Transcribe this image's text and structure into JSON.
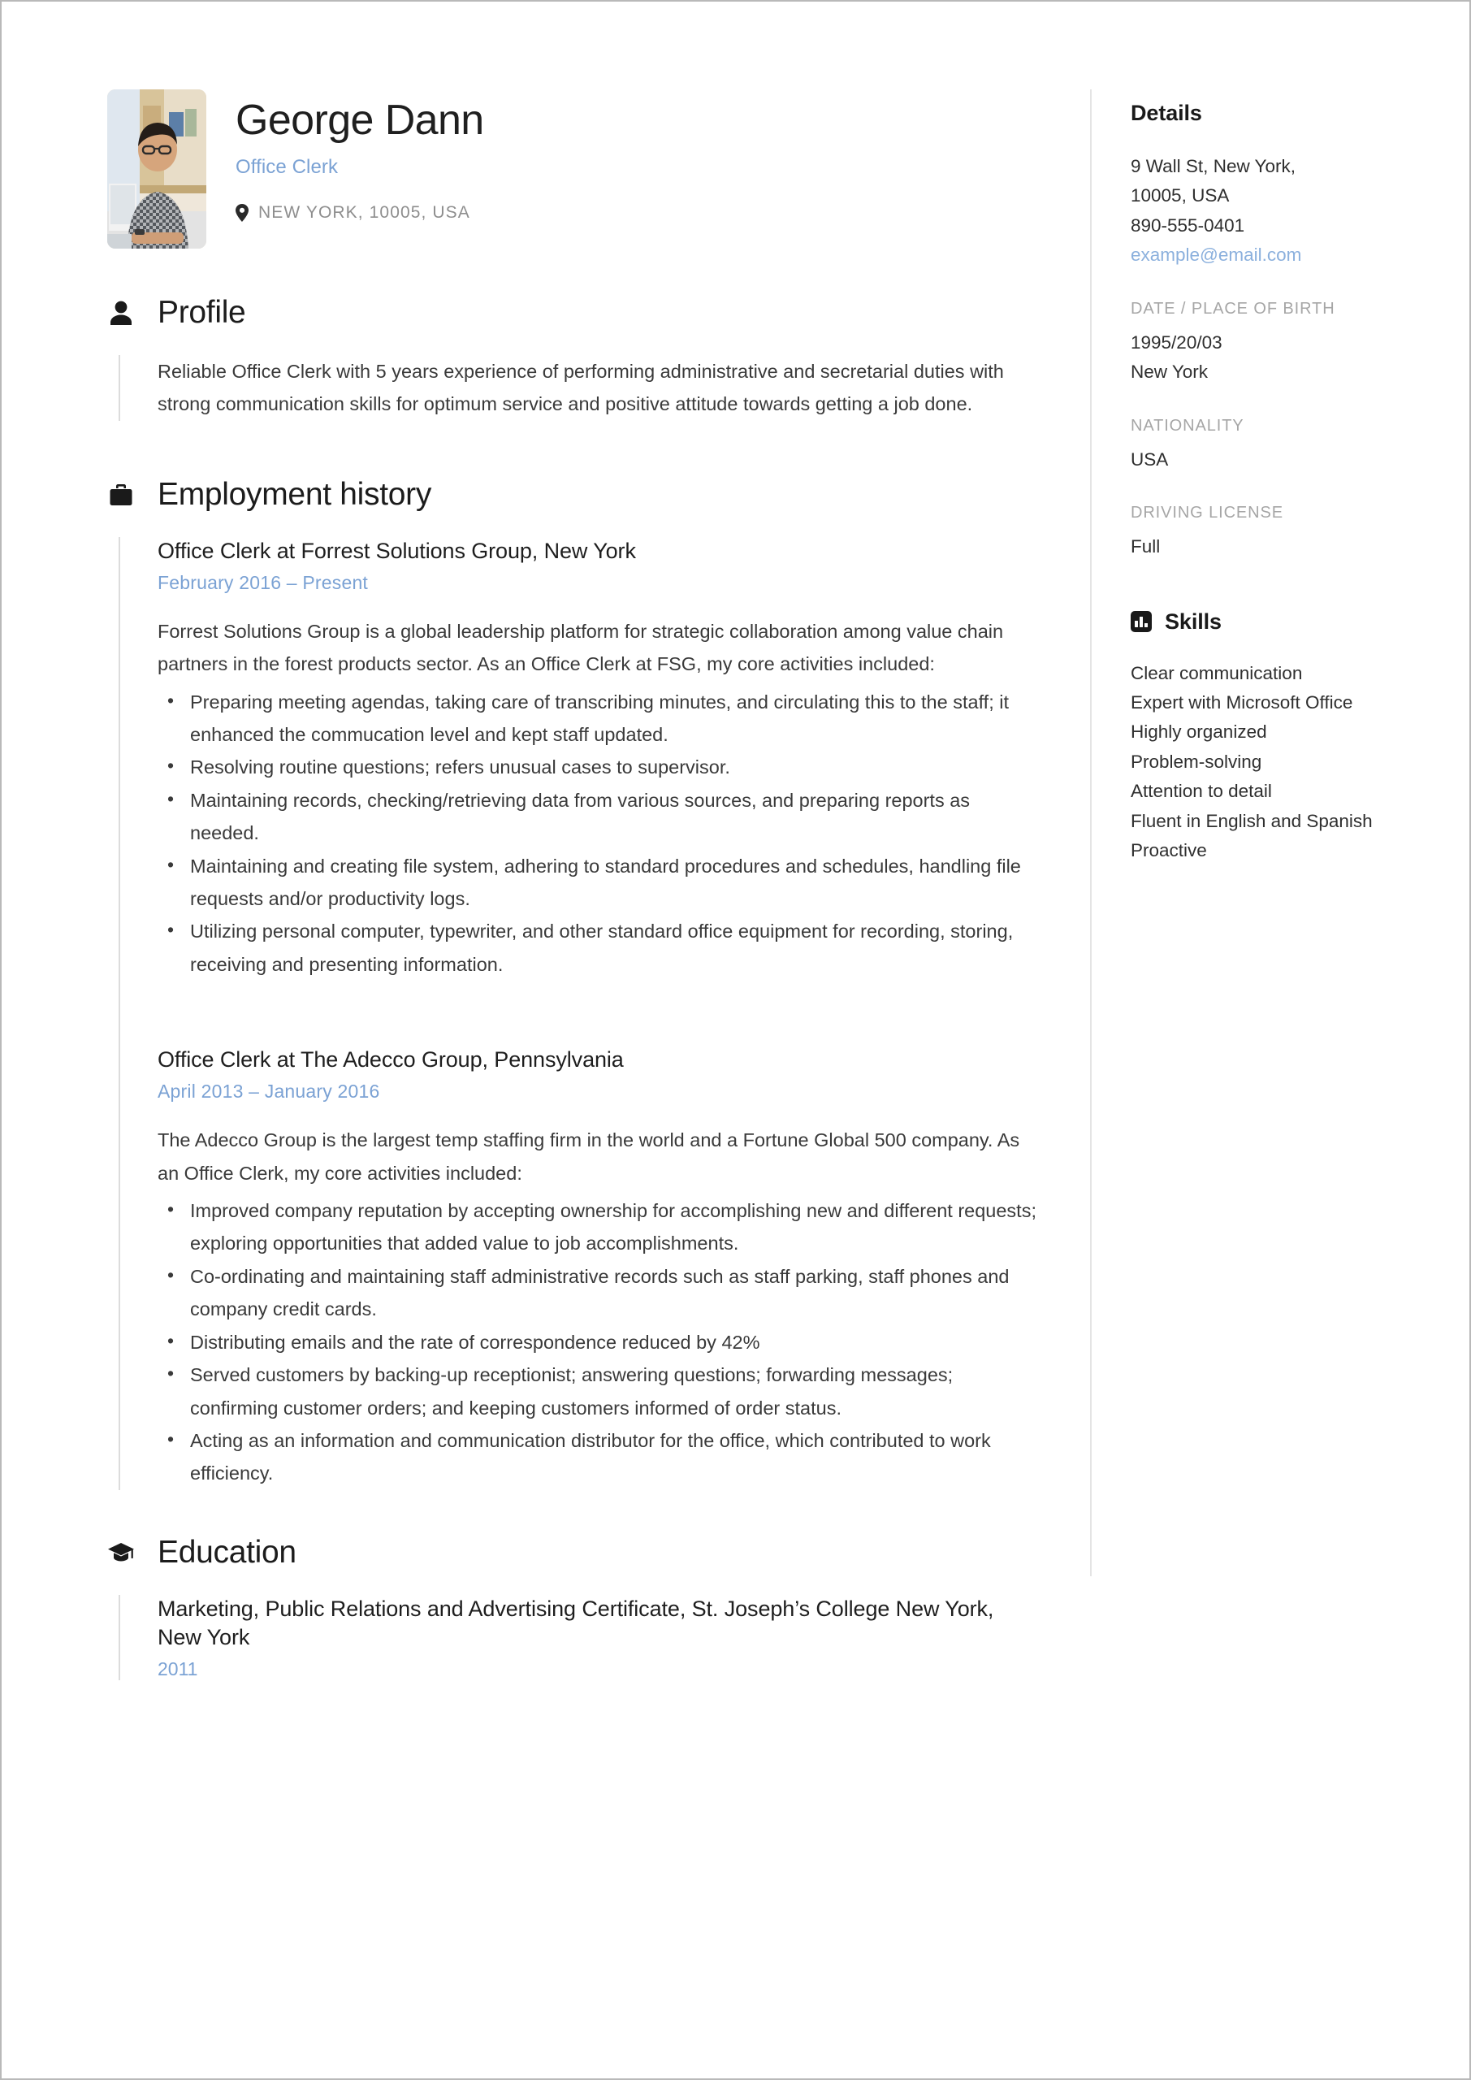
{
  "header": {
    "name": "George Dann",
    "job_title": "Office Clerk",
    "location": "NEW YORK, 10005, USA",
    "location_icon": "map-pin-icon",
    "avatar_alt": "photo of man at office desk"
  },
  "accent_color": "#7ba2d4",
  "sections": [
    {
      "id": "profile",
      "title": "Profile",
      "icon": "person-icon",
      "paragraph": "Reliable Office Clerk with 5 years experience of performing administrative and secretarial duties with strong communication skills for optimum service and positive attitude towards getting a job done."
    },
    {
      "id": "employment-history",
      "title": "Employment history",
      "icon": "briefcase-icon"
    },
    {
      "id": "education",
      "title": "Education",
      "icon": "graduation-cap-icon"
    }
  ],
  "employment": [
    {
      "title": "Office Clerk at Forrest Solutions Group, New York",
      "dates": "February 2016  –  Present",
      "description": "Forrest Solutions Group is a global leadership platform for strategic collaboration among value chain partners in the forest products sector. As an Office Clerk at FSG, my core activities included:",
      "bullets": [
        "Preparing meeting agendas, taking  care of transcribing minutes, and circulating this to the staff; it enhanced the commucation level and kept staff updated.",
        "Resolving  routine questions; refers unusual cases to supervisor.",
        "Maintaining records, checking/retrieving data from various sources, and preparing reports as needed.",
        "Maintaining and creating file system, adhering to standard procedures and schedules, handling file requests and/or productivity logs.",
        "Utilizing personal computer, typewriter, and other standard office equipment for recording, storing, receiving and presenting information."
      ]
    },
    {
      "title": "Office Clerk at The Adecco Group, Pennsylvania",
      "dates": "April 2013  –  January 2016",
      "description": "The Adecco Group is the largest temp staffing firm in the world and a Fortune Global 500 company. As an Office Clerk, my core activities included:",
      "bullets": [
        " Improved company reputation by accepting ownership for accomplishing new and different requests; exploring opportunities that added value to job accomplishments.",
        "Co-ordinating and maintaining staff administrative records such as staff parking, staff phones and company credit cards.",
        "Distributing emails and the rate of correspondence reduced by 42%",
        "Served customers by backing-up receptionist; answering questions; forwarding messages; confirming customer orders; and keeping customers informed of order status.",
        "Acting as an information and communication distributor for the office, which contributed to work efficiency."
      ]
    }
  ],
  "education": [
    {
      "title": "Marketing, Public Relations and Advertising Certificate, St. Joseph’s College New York, New York",
      "year": "2011"
    }
  ],
  "details": {
    "heading": "Details",
    "address_line1": "9 Wall St, New York,",
    "address_line2": "10005, USA",
    "phone": "890-555-0401",
    "email": "example@email.com",
    "dob_label": "DATE / PLACE OF BIRTH",
    "dob_date": "1995/20/03",
    "dob_place": "New York",
    "nationality_label": "NATIONALITY",
    "nationality_value": "USA",
    "license_label": "DRIVING LICENSE",
    "license_value": "Full"
  },
  "skills": {
    "heading": "Skills",
    "icon": "bar-chart-icon",
    "items": [
      "Clear communication",
      "Expert with Microsoft Office",
      "Highly organized",
      "Problem-solving",
      "Attention to detail",
      "Fluent in English and Spanish",
      "Proactive"
    ]
  }
}
